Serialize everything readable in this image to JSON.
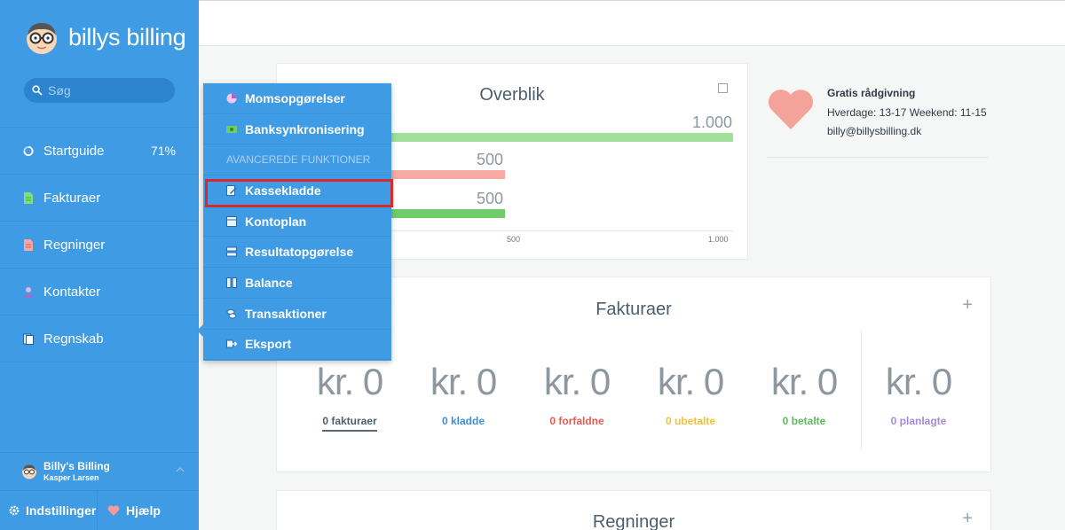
{
  "app": {
    "logo_text": "billys billing"
  },
  "search": {
    "placeholder": "Søg"
  },
  "sidebar": {
    "items": [
      {
        "label": "Startguide",
        "extra": "71%"
      },
      {
        "label": "Fakturaer"
      },
      {
        "label": "Regninger"
      },
      {
        "label": "Kontakter"
      },
      {
        "label": "Regnskab"
      }
    ],
    "user": {
      "company": "Billy's Billing",
      "name": "Kasper Larsen"
    },
    "settings_label": "Indstillinger",
    "help_label": "Hjælp"
  },
  "dropdown": {
    "items_top": [
      "Momsopgørelser",
      "Banksynkronisering"
    ],
    "section_header": "AVANCEREDE FUNKTIONER",
    "items_bottom": [
      "Kassekladde",
      "Kontoplan",
      "Resultatopgørelse",
      "Balance",
      "Transaktioner",
      "Eksport"
    ]
  },
  "overview": {
    "title": "Overblik",
    "bars": [
      {
        "label": "1.000",
        "value": 1000,
        "color": "#9fe09a"
      },
      {
        "label": "500",
        "value": 500,
        "color": "#f6aaa2"
      },
      {
        "label": "500",
        "value": 500,
        "color": "#6ecd6a"
      }
    ],
    "axis_ticks": [
      "500",
      "1.000"
    ],
    "axis_max": 1000
  },
  "advice": {
    "title": "Gratis rådgivning",
    "hours": "Hverdage: 13-17 Weekend: 11-15",
    "email": "billy@billysbilling.dk"
  },
  "fakturaer": {
    "title": "Fakturaer",
    "plus": "+",
    "stats": [
      {
        "amount": "kr. 0",
        "label": "0 fakturaer",
        "color": "#4c5e6e"
      },
      {
        "amount": "kr. 0",
        "label": "0 kladde",
        "color": "#3f8ed8"
      },
      {
        "amount": "kr. 0",
        "label": "0 forfaldne",
        "color": "#e8594f"
      },
      {
        "amount": "kr. 0",
        "label": "0 ubetalte",
        "color": "#f4c136"
      },
      {
        "amount": "kr. 0",
        "label": "0 betalte",
        "color": "#5cbc58"
      },
      {
        "amount": "kr. 0",
        "label": "0 planlagte",
        "color": "#a58bd6"
      }
    ]
  },
  "regninger": {
    "title": "Regninger",
    "plus": "+"
  }
}
